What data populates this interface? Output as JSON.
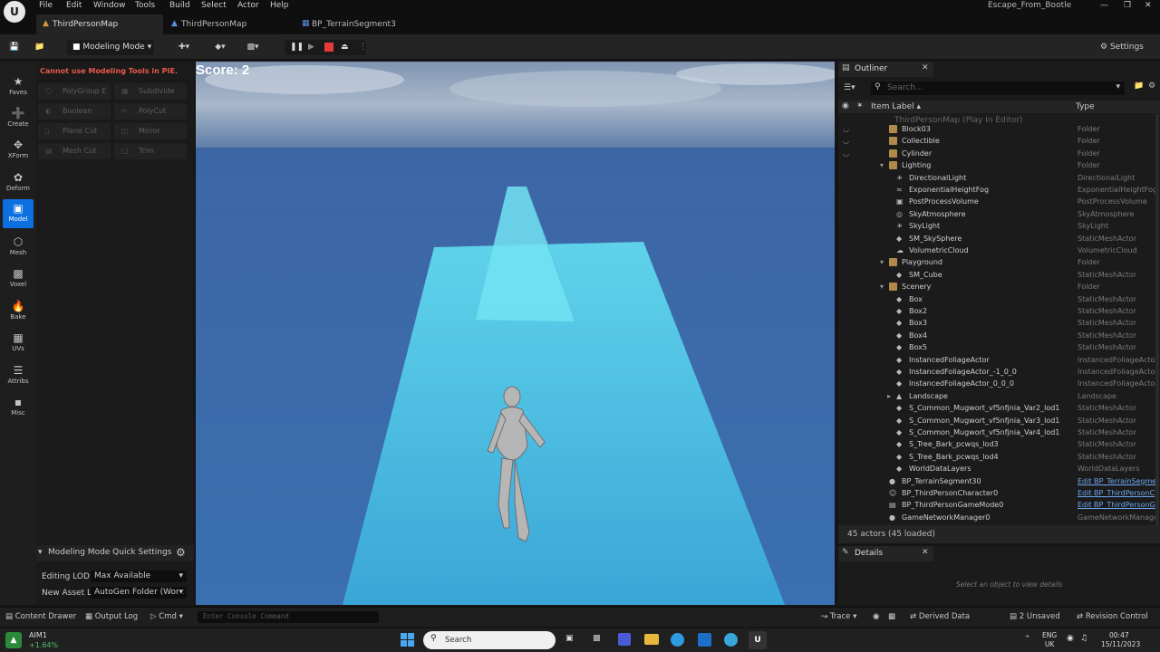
{
  "menubar": {
    "items": [
      "File",
      "Edit",
      "Window",
      "Tools",
      "Build",
      "Select",
      "Actor",
      "Help"
    ],
    "project": "Escape_From_Bootle"
  },
  "tabs": [
    "ThirdPersonMap",
    "ThirdPersonMap",
    "BP_TerrainSegment3"
  ],
  "toolbar": {
    "mode_label": "Modeling Mode",
    "settings_label": "Settings"
  },
  "left_strip": [
    "Faves",
    "Create",
    "XForm",
    "Deform",
    "Model",
    "Mesh",
    "Voxel",
    "Bake",
    "UVs",
    "Attribs",
    "Misc"
  ],
  "tool_panel": {
    "warning": "Cannot use Modeling Tools in PIE.",
    "tools": [
      "PolyGroup E",
      "Subdivide",
      "Boolean",
      "PolyCut",
      "Plane Cut",
      "Mirror",
      "Mesh Cut",
      "Trim"
    ],
    "quick_settings_title": "Modeling Mode Quick Settings",
    "editing_lod_label": "Editing LOD",
    "editing_lod_value": "Max Available",
    "new_asset_label": "New Asset Lo",
    "new_asset_value": "AutoGen Folder (Work"
  },
  "viewport": {
    "score": "Score: 2"
  },
  "outliner": {
    "title": "Outliner",
    "search_placeholder": "Search...",
    "col_label": "Item Label ▴",
    "col_type": "Type",
    "root": "ThirdPersonMap (Play In Editor)",
    "rows": [
      {
        "label": "Block03",
        "type": "Folder",
        "indent": 56,
        "icon": "folder"
      },
      {
        "label": "Collectible",
        "type": "Folder",
        "indent": 56,
        "icon": "folder"
      },
      {
        "label": "Cylinder",
        "type": "Folder",
        "indent": 56,
        "icon": "folder"
      },
      {
        "label": "Lighting",
        "type": "Folder",
        "indent": 56,
        "icon": "folder",
        "expanded": true
      },
      {
        "label": "DirectionalLight",
        "type": "DirectionalLight",
        "indent": 64,
        "icon": "light"
      },
      {
        "label": "ExponentialHeightFog",
        "type": "ExponentialHeightFog",
        "indent": 64,
        "icon": "fog"
      },
      {
        "label": "PostProcessVolume",
        "type": "PostProcessVolume",
        "indent": 64,
        "icon": "volume"
      },
      {
        "label": "SkyAtmosphere",
        "type": "SkyAtmosphere",
        "indent": 64,
        "icon": "sky"
      },
      {
        "label": "SkyLight",
        "type": "SkyLight",
        "indent": 64,
        "icon": "light"
      },
      {
        "label": "SM_SkySphere",
        "type": "StaticMeshActor",
        "indent": 64,
        "icon": "mesh"
      },
      {
        "label": "VolumetricCloud",
        "type": "VolumetricCloud",
        "indent": 64,
        "icon": "cloud"
      },
      {
        "label": "Playground",
        "type": "Folder",
        "indent": 56,
        "icon": "folder",
        "expanded": true
      },
      {
        "label": "SM_Cube",
        "type": "StaticMeshActor",
        "indent": 64,
        "icon": "mesh"
      },
      {
        "label": "Scenery",
        "type": "Folder",
        "indent": 56,
        "icon": "folder",
        "expanded": true
      },
      {
        "label": "Box",
        "type": "StaticMeshActor",
        "indent": 64,
        "icon": "mesh"
      },
      {
        "label": "Box2",
        "type": "StaticMeshActor",
        "indent": 64,
        "icon": "mesh"
      },
      {
        "label": "Box3",
        "type": "StaticMeshActor",
        "indent": 64,
        "icon": "mesh"
      },
      {
        "label": "Box4",
        "type": "StaticMeshActor",
        "indent": 64,
        "icon": "mesh"
      },
      {
        "label": "Box5",
        "type": "StaticMeshActor",
        "indent": 64,
        "icon": "mesh"
      },
      {
        "label": "InstancedFoliageActor",
        "type": "InstancedFoliageActor",
        "indent": 64,
        "icon": "mesh"
      },
      {
        "label": "InstancedFoliageActor_-1_0_0",
        "type": "InstancedFoliageActor",
        "indent": 64,
        "icon": "mesh"
      },
      {
        "label": "InstancedFoliageActor_0_0_0",
        "type": "InstancedFoliageActor",
        "indent": 64,
        "icon": "mesh"
      },
      {
        "label": "Landscape",
        "type": "Landscape",
        "indent": 64,
        "icon": "landscape",
        "collapsed": true
      },
      {
        "label": "S_Common_Mugwort_vf5nfjnia_Var2_lod1",
        "type": "StaticMeshActor",
        "indent": 64,
        "icon": "mesh"
      },
      {
        "label": "S_Common_Mugwort_vf5nfjnia_Var3_lod1",
        "type": "StaticMeshActor",
        "indent": 64,
        "icon": "mesh"
      },
      {
        "label": "S_Common_Mugwort_vf5nfjnia_Var4_lod1",
        "type": "StaticMeshActor",
        "indent": 64,
        "icon": "mesh"
      },
      {
        "label": "S_Tree_Bark_pcwqs_lod3",
        "type": "StaticMeshActor",
        "indent": 64,
        "icon": "mesh"
      },
      {
        "label": "S_Tree_Bark_pcwqs_lod4",
        "type": "StaticMeshActor",
        "indent": 64,
        "icon": "mesh"
      },
      {
        "label": "WorldDataLayers",
        "type": "WorldDataLayers",
        "indent": 64,
        "icon": "mesh"
      },
      {
        "label": "BP_TerrainSegment30",
        "type": "Edit BP_TerrainSegme",
        "indent": 56,
        "icon": "bp",
        "link": true
      },
      {
        "label": "BP_ThirdPersonCharacter0",
        "type": "Edit BP_ThirdPersonC",
        "indent": 56,
        "icon": "char",
        "link": true
      },
      {
        "label": "BP_ThirdPersonGameMode0",
        "type": "Edit BP_ThirdPersonG",
        "indent": 56,
        "icon": "gm",
        "link": true
      },
      {
        "label": "GameNetworkManager0",
        "type": "GameNetworkManage",
        "indent": 56,
        "icon": "net"
      }
    ],
    "footer": "45 actors (45 loaded)"
  },
  "details": {
    "title": "Details",
    "empty": "Select an object to view details"
  },
  "statusbar": {
    "content_drawer": "Content Drawer",
    "output_log": "Output Log",
    "cmd": "Cmd",
    "console_placeholder": "Enter Console Command",
    "trace": "Trace",
    "derived_data": "Derived Data",
    "unsaved": "2 Unsaved",
    "revision": "Revision Control"
  },
  "taskbar": {
    "stock_name": "AIM1",
    "stock_change": "+1.64%",
    "search": "Search",
    "lang": "ENG",
    "region": "UK",
    "time": "00:47",
    "date": "15/11/2023"
  }
}
